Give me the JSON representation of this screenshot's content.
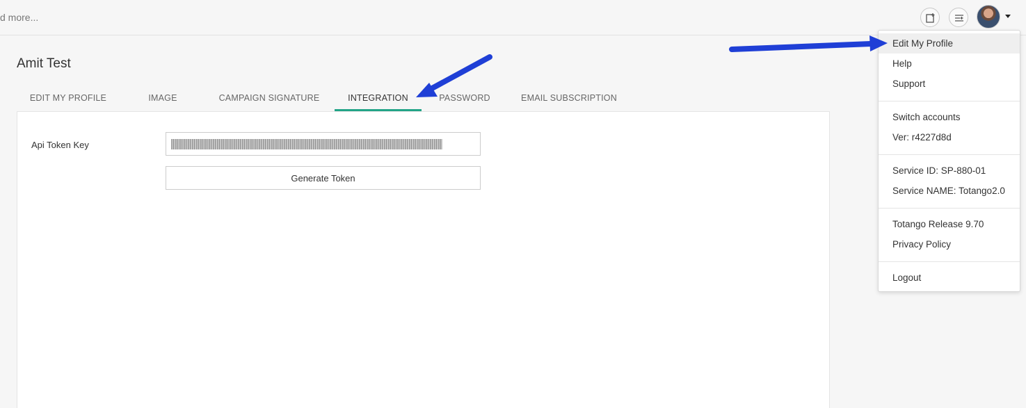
{
  "header": {
    "search_text": "d more...",
    "icons": [
      "add-note-icon",
      "list-add-icon"
    ]
  },
  "page": {
    "title": "Amit Test"
  },
  "tabs": [
    {
      "label": "EDIT MY PROFILE",
      "active": false
    },
    {
      "label": "IMAGE",
      "active": false
    },
    {
      "label": "CAMPAIGN SIGNATURE",
      "active": false
    },
    {
      "label": "INTEGRATION",
      "active": true
    },
    {
      "label": "PASSWORD",
      "active": false
    },
    {
      "label": "EMAIL SUBSCRIPTION",
      "active": false
    }
  ],
  "integration": {
    "api_token_label": "Api Token Key",
    "generate_button": "Generate Token"
  },
  "menu": {
    "edit_profile": "Edit My Profile",
    "help": "Help",
    "support": "Support",
    "switch_accounts": "Switch accounts",
    "version": "Ver:  r4227d8d",
    "service_id": "Service ID: SP-880-01",
    "service_name": "Service NAME: Totango2.0",
    "release": "Totango Release 9.70",
    "privacy": "Privacy Policy",
    "logout": "Logout"
  },
  "colors": {
    "active_tab_underline": "#22a487",
    "annotation_arrow": "#1f3fd6"
  }
}
